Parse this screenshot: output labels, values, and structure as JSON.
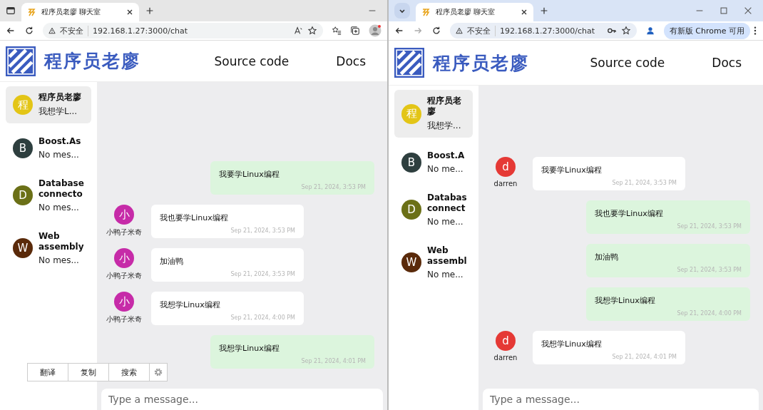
{
  "windows": [
    {
      "kind": "edge",
      "tab_title": "程序员老廖 聊天室",
      "security_label": "不安全",
      "url": "192.168.1.27:3000/chat",
      "logo_text": "程序员老廖",
      "nav": [
        "Source code",
        "Docs"
      ],
      "rooms": [
        {
          "initial": "程",
          "color": "#e3c516",
          "name": "程序员老廖",
          "preview": "我想学L...",
          "selected": true
        },
        {
          "initial": "B",
          "color": "#2e3f3f",
          "name": "Boost.As",
          "preview": "No mes...",
          "selected": false
        },
        {
          "initial": "D",
          "color": "#6b7017",
          "name": "Database connecto",
          "preview": "No mes...",
          "selected": false
        },
        {
          "initial": "W",
          "color": "#5a2a0a",
          "name": "Web assembly",
          "preview": "No mes...",
          "selected": false
        }
      ],
      "messages": [
        {
          "mine": true,
          "text": "我要学Linux编程",
          "time": "Sep 21, 2024, 3:53 PM"
        },
        {
          "mine": false,
          "initial": "小",
          "color": "#c62ba8",
          "sender": "小鸭子米奇",
          "text": "我也要学Linux编程",
          "time": "Sep 21, 2024, 3:53 PM"
        },
        {
          "mine": false,
          "initial": "小",
          "color": "#c62ba8",
          "sender": "小鸭子米奇",
          "text": "加油鸭",
          "time": "Sep 21, 2024, 3:53 PM"
        },
        {
          "mine": false,
          "initial": "小",
          "color": "#c62ba8",
          "sender": "小鸭子米奇",
          "text": "我想学Linux编程",
          "time": "Sep 21, 2024, 4:00 PM"
        },
        {
          "mine": true,
          "text": "我想学Linux编程",
          "time": "Sep 21, 2024, 4:01 PM"
        }
      ],
      "input_placeholder": "Type a message...",
      "selection_toolbar": [
        "翻译",
        "复制",
        "搜索"
      ]
    },
    {
      "kind": "chrome",
      "tab_title": "程序员老廖 聊天室",
      "security_label": "不安全",
      "url": "192.168.1.27:3000/chat",
      "update_button": "有新版 Chrome 可用",
      "logo_text": "程序员老廖",
      "nav": [
        "Source code",
        "Docs"
      ],
      "rooms": [
        {
          "initial": "程",
          "color": "#e3c516",
          "name": "程序员老廖",
          "preview": "我想学...",
          "selected": true
        },
        {
          "initial": "B",
          "color": "#2e3f3f",
          "name": "Boost.A",
          "preview": "No me...",
          "selected": false
        },
        {
          "initial": "D",
          "color": "#6b7017",
          "name": "Databas connect",
          "preview": "No me...",
          "selected": false
        },
        {
          "initial": "W",
          "color": "#5a2a0a",
          "name": "Web assembl",
          "preview": "No me...",
          "selected": false
        }
      ],
      "messages": [
        {
          "mine": false,
          "initial": "d",
          "color": "#e53935",
          "sender": "darren",
          "text": "我要学Linux编程",
          "time": "Sep 21, 2024, 3:53 PM"
        },
        {
          "mine": true,
          "text": "我也要学Linux编程",
          "time": "Sep 21, 2024, 3:53 PM"
        },
        {
          "mine": true,
          "text": "加油鸭",
          "time": "Sep 21, 2024, 3:53 PM"
        },
        {
          "mine": true,
          "text": "我想学Linux编程",
          "time": "Sep 21, 2024, 4:00 PM"
        },
        {
          "mine": false,
          "initial": "d",
          "color": "#e53935",
          "sender": "darren",
          "text": "我想学Linux编程",
          "time": "Sep 21, 2024, 4:01 PM"
        }
      ],
      "input_placeholder": "Type a message..."
    }
  ]
}
